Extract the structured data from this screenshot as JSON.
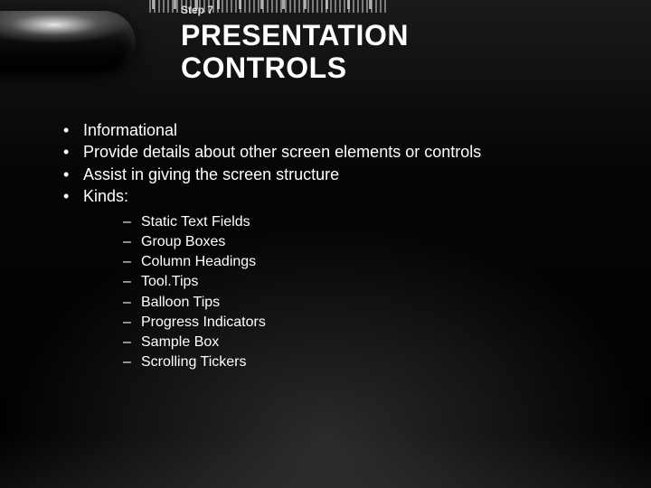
{
  "header": {
    "step": "Step 7",
    "title_line1": "PRESENTATION",
    "title_line2": "CONTROLS"
  },
  "bullets": [
    "Informational",
    "Provide details about other screen elements or controls",
    "Assist in giving the screen structure",
    "Kinds:"
  ],
  "kinds": [
    "Static Text Fields",
    "Group Boxes",
    "Column Headings",
    "Tool.Tips",
    "Balloon Tips",
    "Progress Indicators",
    "Sample Box",
    "Scrolling Tickers"
  ]
}
